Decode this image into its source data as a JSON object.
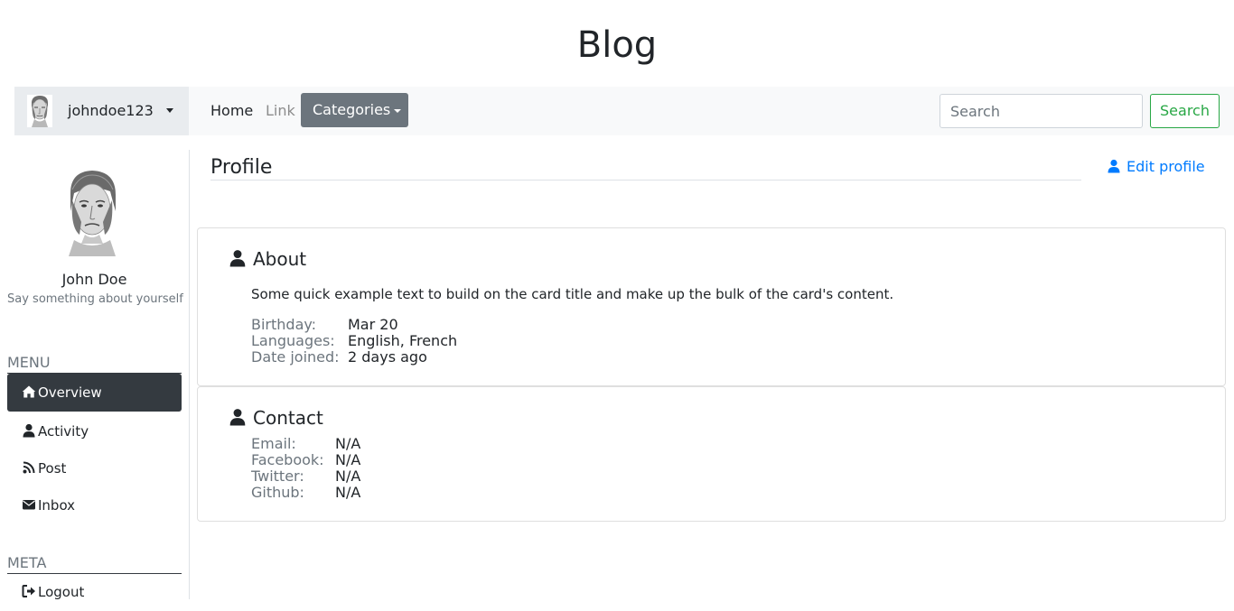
{
  "site": {
    "title": "Blog"
  },
  "navbar": {
    "username": "johndoe123",
    "links": {
      "home": "Home",
      "link": "Link"
    },
    "categories_label": "Categories",
    "search_placeholder": "Search",
    "search_button": "Search"
  },
  "sidebar": {
    "name": "John Doe",
    "tagline": "Say something about yourself",
    "menu_heading": "MENU",
    "menu_items": [
      {
        "label": "Overview",
        "icon": "home-icon",
        "active": true
      },
      {
        "label": "Activity",
        "icon": "user-icon"
      },
      {
        "label": "Post",
        "icon": "rss-icon"
      },
      {
        "label": "Inbox",
        "icon": "envelope-icon"
      }
    ],
    "meta_heading": "META",
    "meta_items": [
      {
        "label": "Logout",
        "icon": "sign-out-icon"
      }
    ]
  },
  "content": {
    "title": "Profile",
    "edit_label": "Edit profile",
    "about": {
      "title": "About",
      "text": "Some quick example text to build on the card title and make up the bulk of the card's content.",
      "fields": [
        {
          "label": "Birthday:",
          "value": "Mar 20"
        },
        {
          "label": "Languages:",
          "value": "English, French"
        },
        {
          "label": "Date joined:",
          "value": "2 days ago"
        }
      ]
    },
    "contact": {
      "title": "Contact",
      "fields": [
        {
          "label": "Email:",
          "value": "N/A"
        },
        {
          "label": "Facebook:",
          "value": "N/A"
        },
        {
          "label": "Twitter:",
          "value": "N/A"
        },
        {
          "label": "Github:",
          "value": "N/A"
        }
      ]
    }
  },
  "colors": {
    "accent": "#007bff",
    "success": "#28a745",
    "dark": "#343a40",
    "secondary": "#6c757d"
  }
}
